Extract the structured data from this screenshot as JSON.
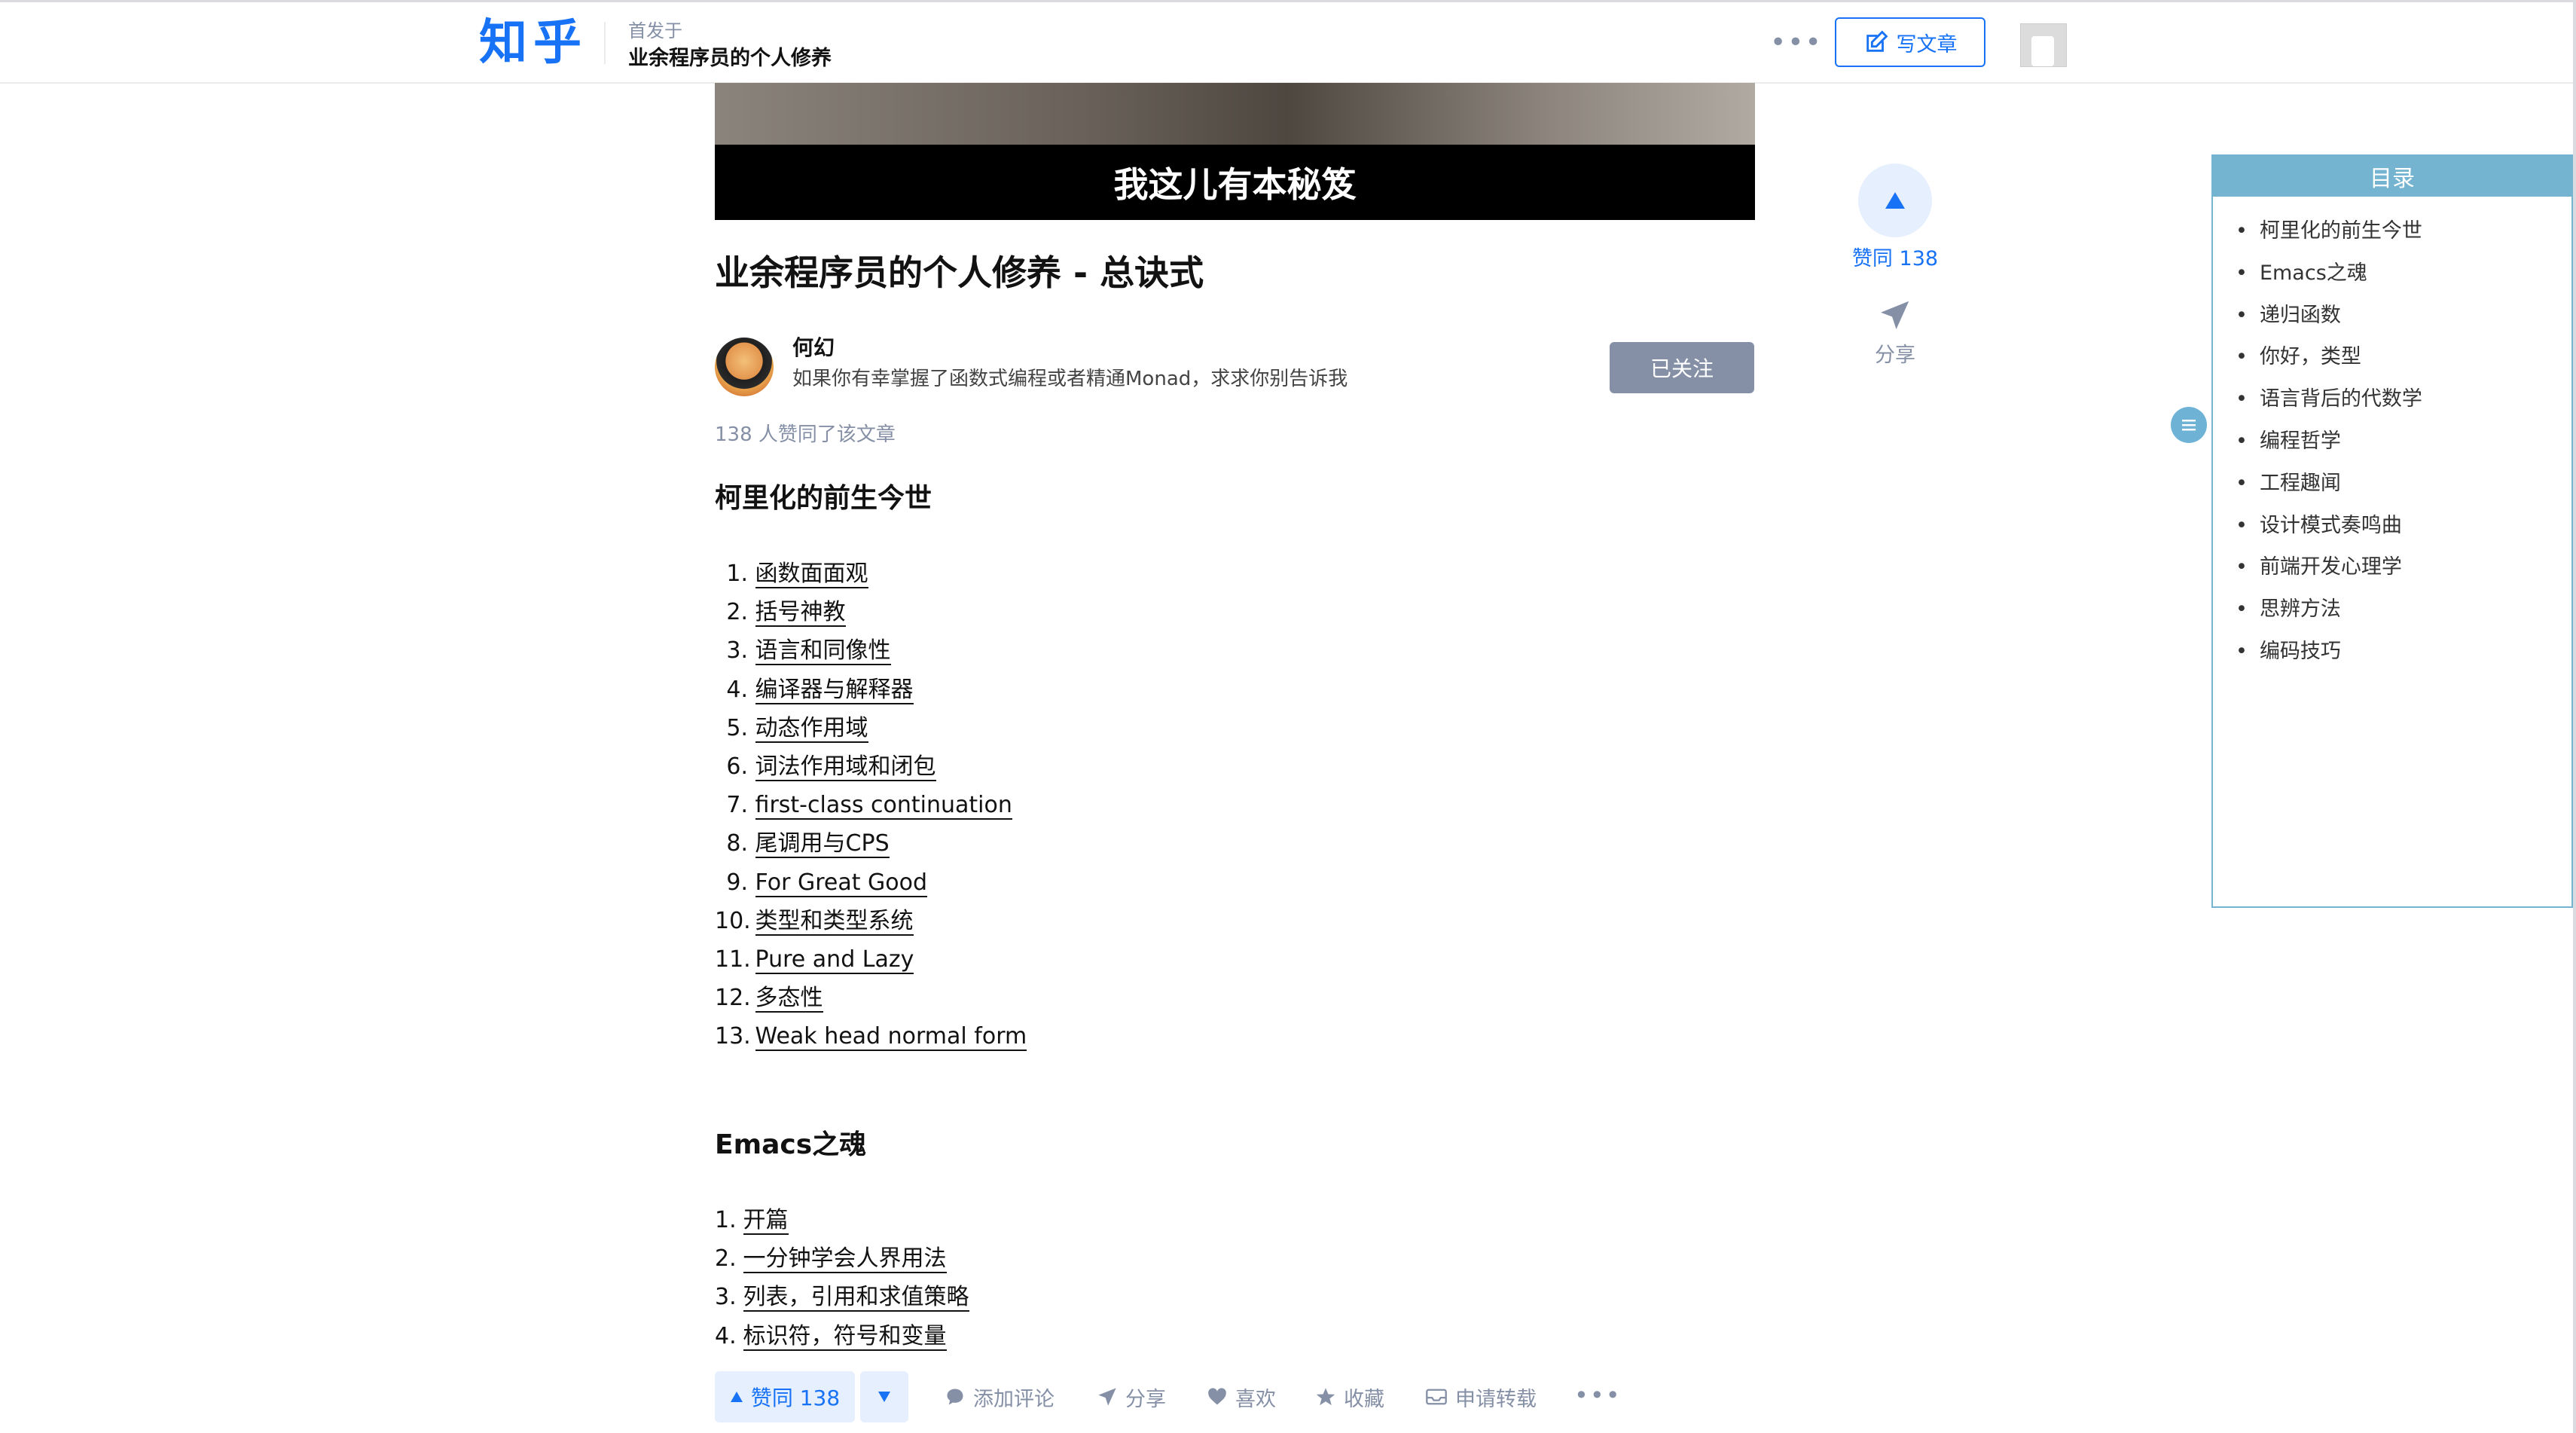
{
  "header": {
    "logo": "知乎",
    "published_in_label": "首发于",
    "column_title": "业余程序员的个人修养",
    "more_label": "•••",
    "write_label": "写文章"
  },
  "banner": {
    "caption": "我这儿有本秘笈"
  },
  "article": {
    "title": "业余程序员的个人修养 - 总诀式",
    "author_name": "何幻",
    "author_bio": "如果你有幸掌握了函数式编程或者精通Monad，求求你别告诉我",
    "follow_label": "已关注",
    "likes_text": "138 人赞同了该文章",
    "sections": [
      {
        "title": "柯里化的前生今世",
        "items": [
          {
            "num": "1.",
            "text": "函数面面观"
          },
          {
            "num": "2.",
            "text": "括号神教"
          },
          {
            "num": "3.",
            "text": "语言和同像性"
          },
          {
            "num": "4.",
            "text": "编译器与解释器"
          },
          {
            "num": "5.",
            "text": "动态作用域"
          },
          {
            "num": "6.",
            "text": "词法作用域和闭包"
          },
          {
            "num": "7.",
            "text": "first-class continuation"
          },
          {
            "num": "8.",
            "text": "尾调用与CPS"
          },
          {
            "num": "9.",
            "text": "For Great Good"
          },
          {
            "num": "10.",
            "text": "类型和类型系统"
          },
          {
            "num": "11.",
            "text": "Pure and Lazy"
          },
          {
            "num": "12.",
            "text": "多态性"
          },
          {
            "num": "13.",
            "text": "Weak head normal form"
          }
        ]
      },
      {
        "title": "Emacs之魂",
        "items": [
          {
            "num": "1.",
            "text": "开篇"
          },
          {
            "num": "2.",
            "text": "一分钟学会人界用法"
          },
          {
            "num": "3.",
            "text": "列表，引用和求值策略"
          },
          {
            "num": "4.",
            "text": "标识符，符号和变量"
          }
        ]
      }
    ]
  },
  "side": {
    "vote_label": "赞同 138",
    "share_label": "分享"
  },
  "toc": {
    "title": "目录",
    "items": [
      "柯里化的前生今世",
      "Emacs之魂",
      "递归函数",
      "你好，类型",
      "语言背后的代数学",
      "编程哲学",
      "工程趣闻",
      "设计模式奏鸣曲",
      "前端开发心理学",
      "思辨方法",
      "编码技巧"
    ]
  },
  "actions": {
    "vote_label": "赞同 138",
    "comment_label": "添加评论",
    "share_label": "分享",
    "like_label": "喜欢",
    "collect_label": "收藏",
    "repost_label": "申请转载",
    "more_label": "•••"
  },
  "colors": {
    "brand": "#1772f6",
    "toc_accent": "#75b4d0",
    "muted": "#8590a6"
  },
  "icons": [
    "edit-icon",
    "triangle-up-icon",
    "paper-plane-icon",
    "list-icon",
    "triangle-down-icon",
    "comment-icon",
    "heart-icon",
    "star-icon",
    "inbox-icon"
  ]
}
